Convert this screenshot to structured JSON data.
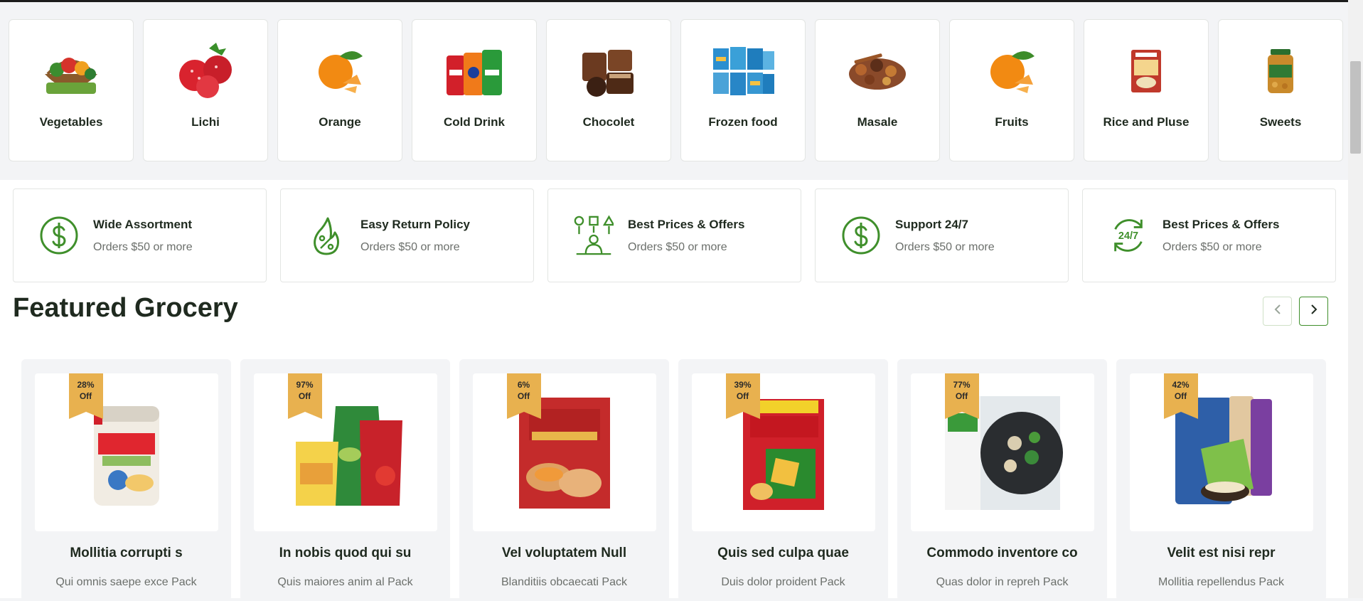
{
  "categories": [
    {
      "label": "Vegetables",
      "icon": "vegetables-basket-image"
    },
    {
      "label": "Lichi",
      "icon": "lichi-image"
    },
    {
      "label": "Orange",
      "icon": "orange-image"
    },
    {
      "label": "Cold Drink",
      "icon": "cold-drink-image"
    },
    {
      "label": "Chocolet",
      "icon": "chocolate-image"
    },
    {
      "label": "Frozen food",
      "icon": "frozen-food-image"
    },
    {
      "label": "Masale",
      "icon": "spices-image"
    },
    {
      "label": "Fruits",
      "icon": "orange-image"
    },
    {
      "label": "Rice and Pluse",
      "icon": "rice-pack-image"
    },
    {
      "label": "Sweets",
      "icon": "sweets-jar-image"
    }
  ],
  "features": [
    {
      "title": "Wide Assortment",
      "subtitle": "Orders $50 or more",
      "icon": "dollar-circle-icon"
    },
    {
      "title": "Easy Return Policy",
      "subtitle": "Orders $50 or more",
      "icon": "percent-drop-icon"
    },
    {
      "title": "Best Prices & Offers",
      "subtitle": "Orders $50 or more",
      "icon": "shapes-person-icon"
    },
    {
      "title": "Support 24/7",
      "subtitle": "Orders $50 or more",
      "icon": "dollar-circle-icon"
    },
    {
      "title": "Best Prices & Offers",
      "subtitle": "Orders $50 or more",
      "icon": "support-24-7-icon"
    }
  ],
  "featured": {
    "heading": "Featured Grocery",
    "prev_icon": "chevron-left-icon",
    "next_icon": "chevron-right-icon"
  },
  "products": [
    {
      "badge_pct": "28%",
      "badge_off": "Off",
      "name": "Mollitia corrupti s",
      "desc": "Qui omnis saepe exce Pack"
    },
    {
      "badge_pct": "97%",
      "badge_off": "Off",
      "name": "In nobis quod qui su",
      "desc": "Quis maiores anim al Pack"
    },
    {
      "badge_pct": "6%",
      "badge_off": "Off",
      "name": "Vel voluptatem Null",
      "desc": "Blanditiis obcaecati Pack"
    },
    {
      "badge_pct": "39%",
      "badge_off": "Off",
      "name": "Quis sed culpa quae",
      "desc": "Duis dolor proident Pack"
    },
    {
      "badge_pct": "77%",
      "badge_off": "Off",
      "name": "Commodo inventore co",
      "desc": "Quas dolor in repreh Pack"
    },
    {
      "badge_pct": "42%",
      "badge_off": "Off",
      "name": "Velit est nisi repr",
      "desc": "Mollitia repellendus Pack"
    }
  ],
  "colors": {
    "accent": "#3f8f2b",
    "badge": "#e8b14f",
    "heading": "#1f2a1f",
    "muted": "#6b6f6b"
  }
}
